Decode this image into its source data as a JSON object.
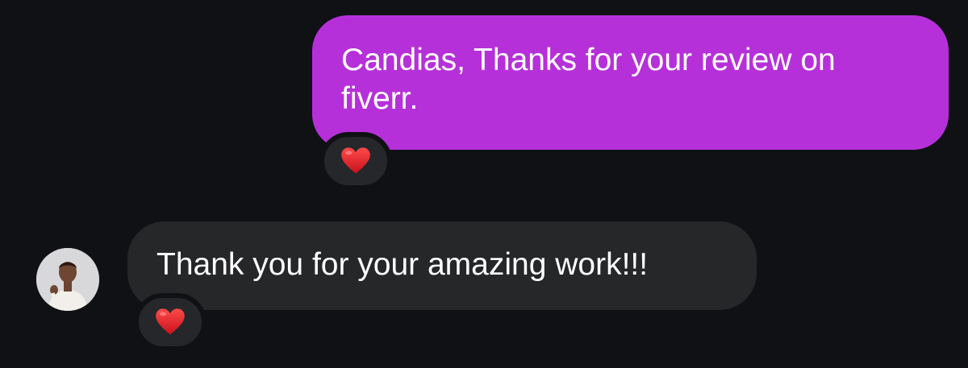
{
  "messages": [
    {
      "direction": "outgoing",
      "text": "Candias, Thanks for your review on fiverr.",
      "reaction": "heart-icon"
    },
    {
      "direction": "incoming",
      "text": "Thank you for your amazing work!!!",
      "reaction": "heart-icon",
      "sender_avatar": "avatar"
    }
  ],
  "colors": {
    "background": "#0f1114",
    "outgoing_bubble": "#b630d9",
    "incoming_bubble": "#262729",
    "reaction_pill": "#26272a",
    "heart": "#e0202c",
    "text": "#ffffff"
  }
}
